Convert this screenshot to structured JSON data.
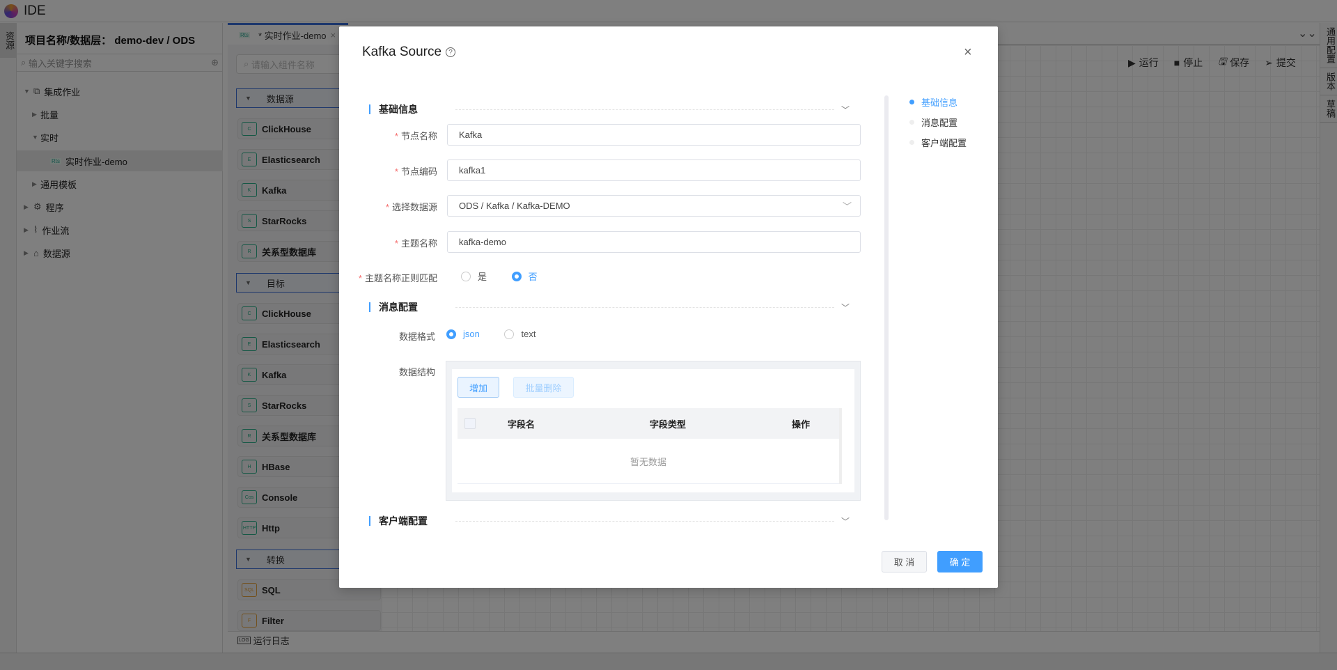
{
  "app": {
    "title": "IDE"
  },
  "left_strip": {
    "tab": "资源"
  },
  "left_panel": {
    "project_title": "项目名称/数据层：  demo-dev / ODS",
    "search_placeholder": "输入关键字搜索",
    "tree": [
      {
        "label": "集成作业",
        "level": 0,
        "expanded": true,
        "icon": "integration-icon"
      },
      {
        "label": "批量",
        "level": 1,
        "expanded": false
      },
      {
        "label": "实时",
        "level": 1,
        "expanded": true
      },
      {
        "label": "实时作业-demo",
        "level": 2,
        "badge": "Rts",
        "selected": true
      },
      {
        "label": "通用模板",
        "level": 1,
        "expanded": false
      },
      {
        "label": "程序",
        "level": 0,
        "expanded": false,
        "icon": "gear-icon"
      },
      {
        "label": "作业流",
        "level": 0,
        "expanded": false,
        "icon": "workflow-icon"
      },
      {
        "label": "数据源",
        "level": 0,
        "expanded": false,
        "icon": "datasource-icon"
      }
    ]
  },
  "editor_tab": {
    "badge": "Rts",
    "label": "* 实时作业-demo"
  },
  "component_panel": {
    "search_placeholder": "请输入组件名称",
    "groups": [
      {
        "label": "数据源",
        "items": [
          {
            "label": "ClickHouse",
            "icon": "C"
          },
          {
            "label": "Elasticsearch",
            "icon": "E"
          },
          {
            "label": "Kafka",
            "icon": "K"
          },
          {
            "label": "StarRocks",
            "icon": "S"
          },
          {
            "label": "关系型数据库",
            "icon": "R"
          }
        ]
      },
      {
        "label": "目标",
        "items": [
          {
            "label": "ClickHouse",
            "icon": "C"
          },
          {
            "label": "Elasticsearch",
            "icon": "E"
          },
          {
            "label": "Kafka",
            "icon": "K"
          },
          {
            "label": "StarRocks",
            "icon": "S"
          },
          {
            "label": "关系型数据库",
            "icon": "R"
          },
          {
            "label": "HBase",
            "icon": "H"
          },
          {
            "label": "Console",
            "icon": "Cos"
          },
          {
            "label": "Http",
            "icon": "HTTP"
          }
        ]
      },
      {
        "label": "转换",
        "items": [
          {
            "label": "SQL",
            "icon": "SQL"
          },
          {
            "label": "Filter",
            "icon": "F"
          }
        ]
      }
    ]
  },
  "toolbar": {
    "run": "运行",
    "stop": "停止",
    "save": "保存",
    "submit": "提交"
  },
  "right_strip": {
    "tabs": [
      "通用配置",
      "版本",
      "草稿"
    ]
  },
  "log_bar": {
    "label": "运行日志",
    "icon": "LOG"
  },
  "modal": {
    "title": "Kafka Source",
    "sections": {
      "basic": "基础信息",
      "message": "消息配置",
      "client": "客户端配置"
    },
    "fields": {
      "node_name": {
        "label": "节点名称",
        "value": "Kafka"
      },
      "node_code": {
        "label": "节点编码",
        "value": "kafka1"
      },
      "datasource": {
        "label": "选择数据源",
        "value": "ODS / Kafka / Kafka-DEMO"
      },
      "topic": {
        "label": "主题名称",
        "value": "kafka-demo"
      },
      "topic_regex": {
        "label": "主题名称正则匹配",
        "options": [
          "是",
          "否"
        ],
        "selected": "否"
      },
      "data_format": {
        "label": "数据格式",
        "options": [
          "json",
          "text"
        ],
        "selected": "json"
      },
      "data_structure": {
        "label": "数据结构",
        "add_button": "增加",
        "batch_delete_button": "批量删除",
        "columns": [
          "字段名",
          "字段类型",
          "操作"
        ],
        "empty_text": "暂无数据"
      }
    },
    "nav": [
      {
        "label": "基础信息",
        "active": true
      },
      {
        "label": "消息配置",
        "active": false
      },
      {
        "label": "客户端配置",
        "active": false
      }
    ],
    "cancel": "取 消",
    "confirm": "确 定"
  },
  "colors": {
    "primary": "#409eff",
    "required": "#f56c6c",
    "accent_border": "#3a6fd8"
  }
}
